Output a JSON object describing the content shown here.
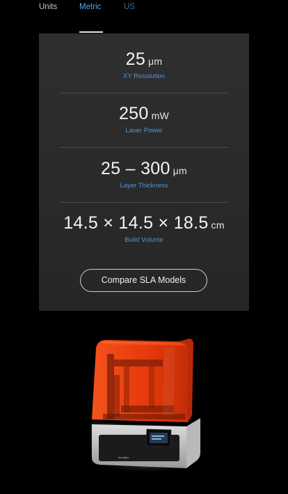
{
  "tabs": {
    "label": "Units",
    "metric": "Metric",
    "us": "US"
  },
  "specs": [
    {
      "value": "25",
      "unit": "μm",
      "label": "XY Resolution"
    },
    {
      "value": "250",
      "unit": "mW",
      "label": "Laser Power"
    },
    {
      "value": "25 – 300",
      "unit": "μm",
      "label": "Layer Thickness"
    },
    {
      "value": "14.5 × 14.5 × 18.5",
      "unit": "cm",
      "label": "Build Volume"
    }
  ],
  "compare_button": "Compare SLA Models",
  "printer": {
    "brand": "formlabs"
  },
  "colors": {
    "accent": "#4f97d6",
    "card_bg": "#2b2b2b",
    "printer_cover": "#e8380d"
  }
}
